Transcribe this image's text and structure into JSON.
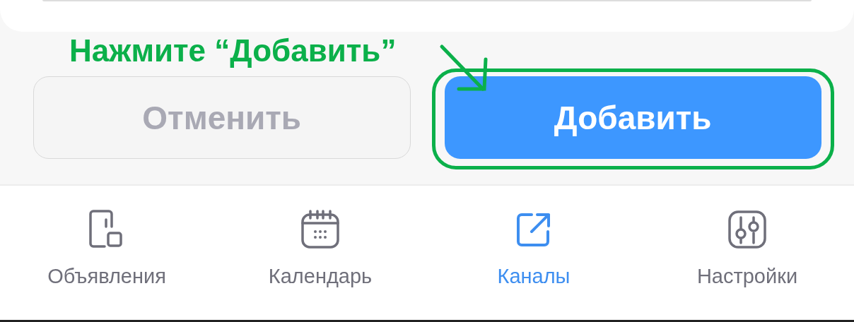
{
  "annotation": {
    "text": "Нажмите “Добавить”"
  },
  "buttons": [
    {
      "label": "Отменить",
      "kind": "secondary",
      "disabled": true
    },
    {
      "label": "Добавить",
      "kind": "primary",
      "disabled": false,
      "highlighted": true
    }
  ],
  "tabs": [
    {
      "label": "Объявления",
      "kind": "phone",
      "selected": false
    },
    {
      "label": "Календарь",
      "kind": "calendar",
      "selected": false
    },
    {
      "label": "Каналы",
      "kind": "share",
      "selected": true
    },
    {
      "label": "Настройки",
      "kind": "sliders",
      "selected": false
    }
  ]
}
